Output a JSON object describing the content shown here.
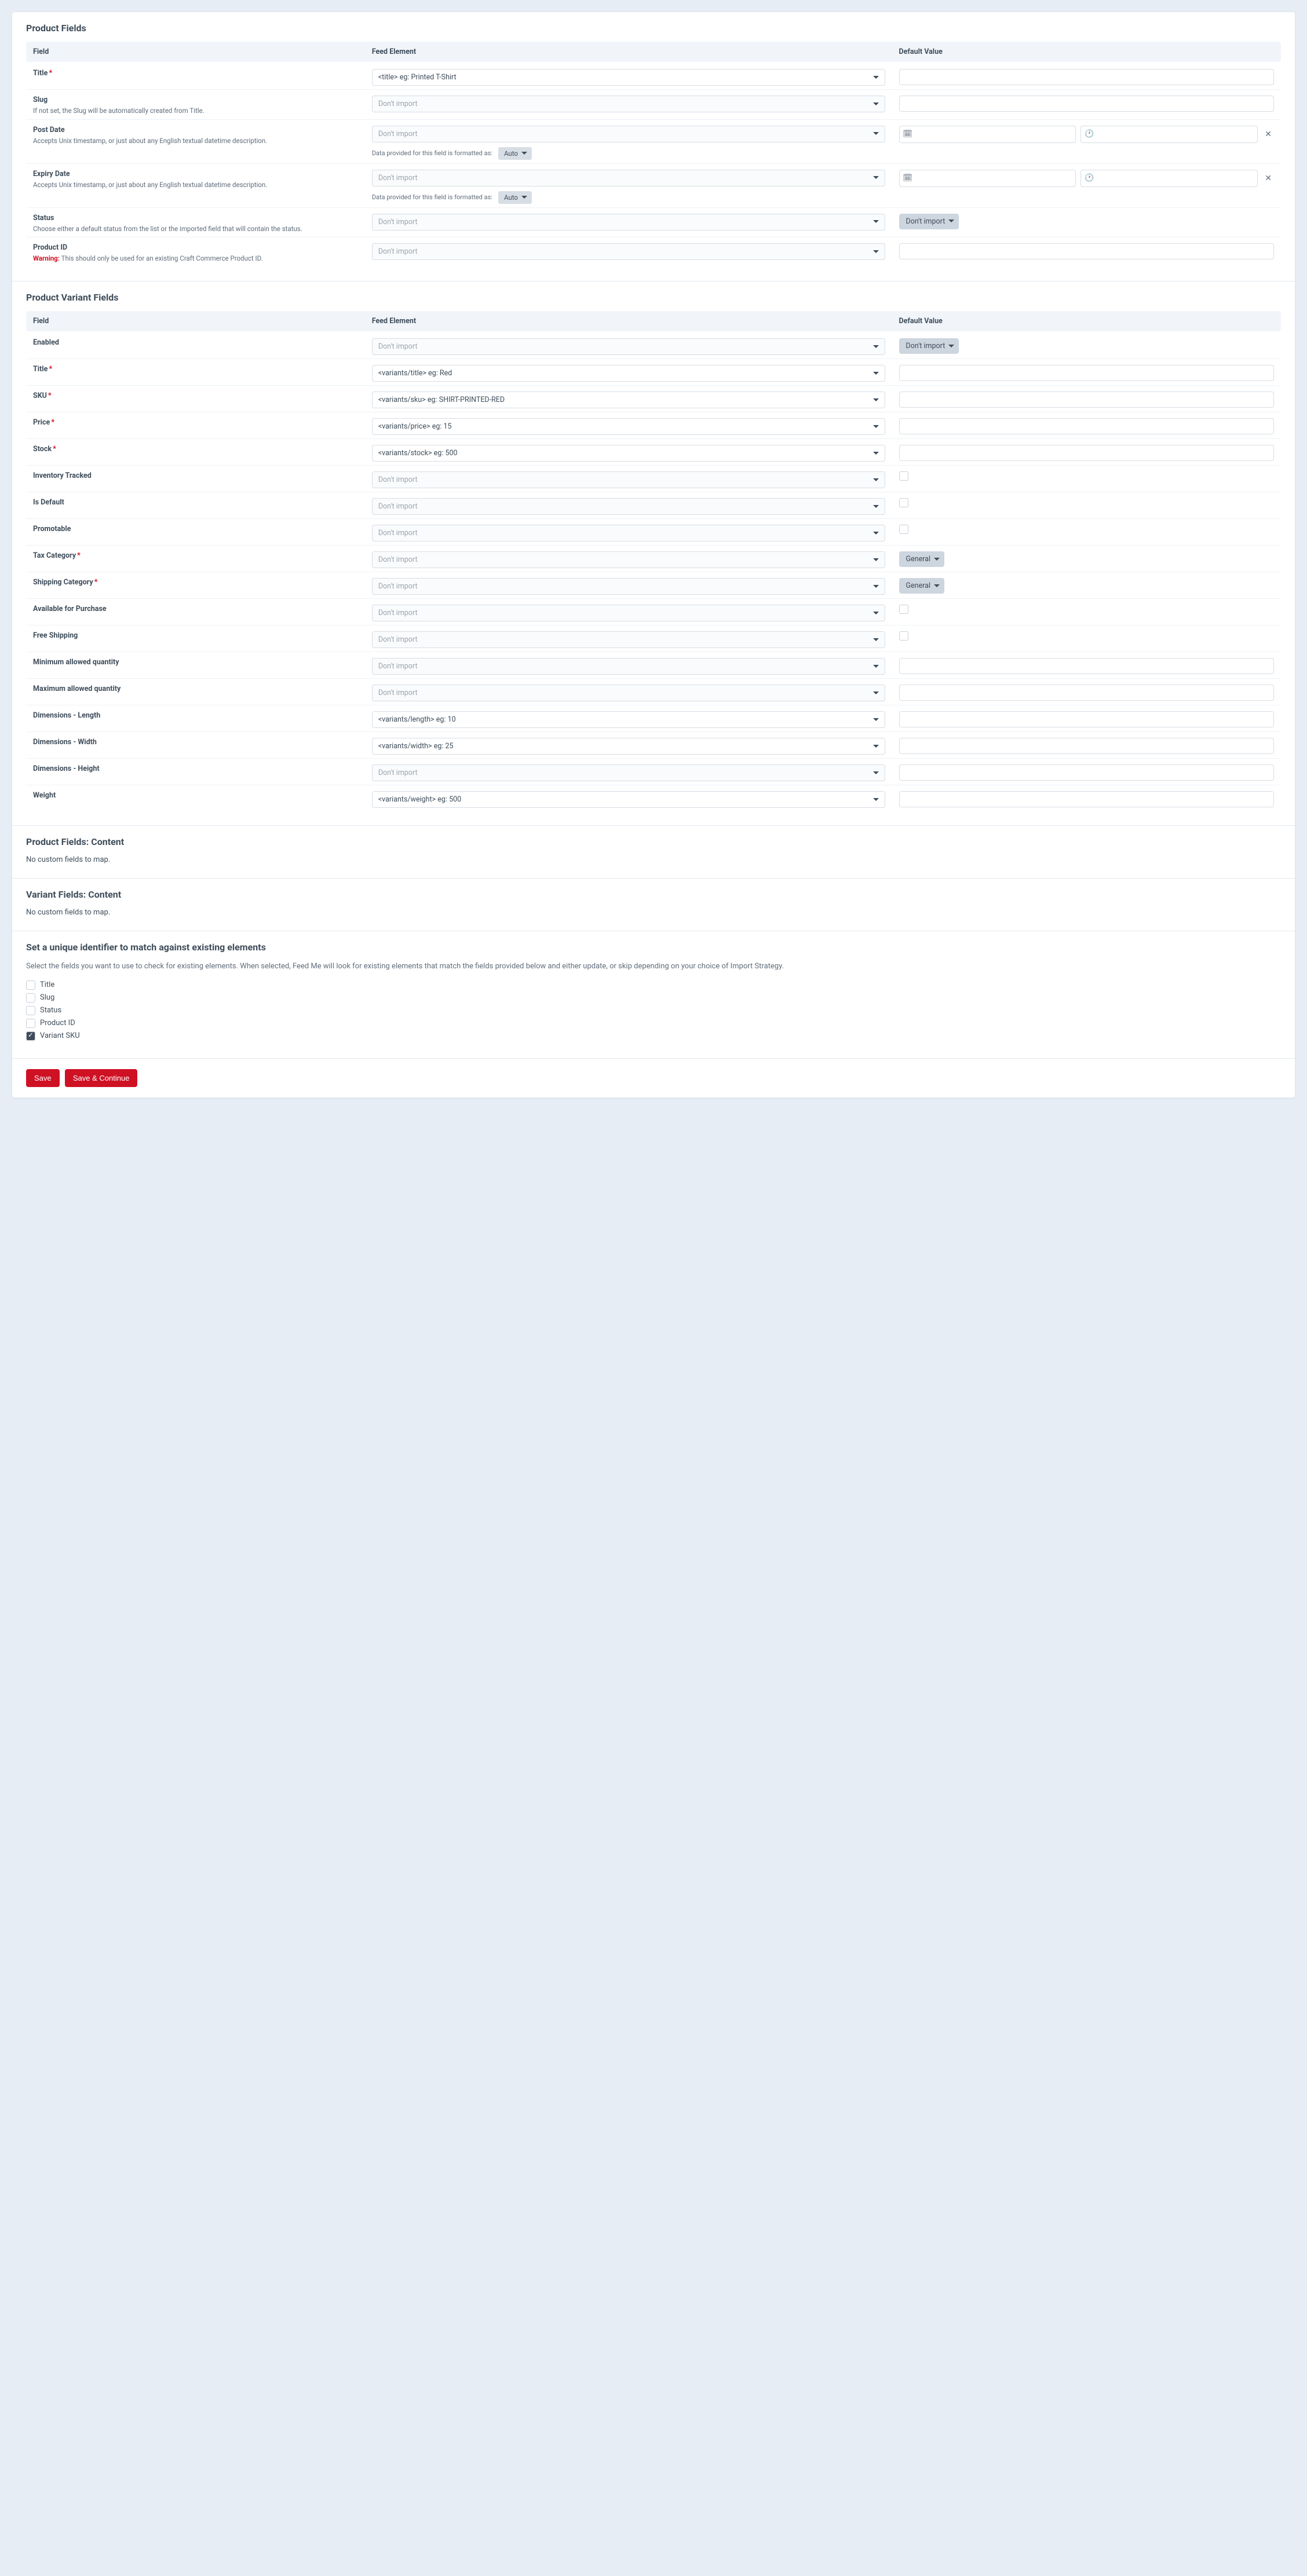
{
  "headers": {
    "field": "Field",
    "feed": "Feed Element",
    "default": "Default Value"
  },
  "common": {
    "dontImport": "Don't import",
    "formatLabel": "Data provided for this field is formatted as:",
    "auto": "Auto",
    "general": "General"
  },
  "sections": {
    "productFields": "Product Fields",
    "variantFields": "Product Variant Fields",
    "productContent": "Product Fields: Content",
    "variantContent": "Variant Fields: Content",
    "unique": "Set a unique identifier to match against existing elements"
  },
  "product": {
    "title": {
      "label": "Title",
      "value": "<title> eg: Printed T-Shirt"
    },
    "slug": {
      "label": "Slug",
      "desc": "If not set, the Slug will be automatically created from Title."
    },
    "postDate": {
      "label": "Post Date",
      "desc": "Accepts Unix timestamp, or just about any English textual datetime description."
    },
    "expiryDate": {
      "label": "Expiry Date",
      "desc": "Accepts Unix timestamp, or just about any English textual datetime description."
    },
    "status": {
      "label": "Status",
      "desc": "Choose either a default status from the list or the imported field that will contain the status."
    },
    "productId": {
      "label": "Product ID",
      "warning": "Warning:",
      "desc": " This should only be used for an existing Craft Commerce Product ID."
    }
  },
  "variant": {
    "enabled": {
      "label": "Enabled"
    },
    "title": {
      "label": "Title",
      "value": "<variants/title> eg: Red"
    },
    "sku": {
      "label": "SKU",
      "value": "<variants/sku> eg: SHIRT-PRINTED-RED"
    },
    "price": {
      "label": "Price",
      "value": "<variants/price> eg: 15"
    },
    "stock": {
      "label": "Stock",
      "value": "<variants/stock> eg: 500"
    },
    "inventoryTracked": {
      "label": "Inventory Tracked"
    },
    "isDefault": {
      "label": "Is Default"
    },
    "promotable": {
      "label": "Promotable"
    },
    "taxCategory": {
      "label": "Tax Category"
    },
    "shippingCategory": {
      "label": "Shipping Category"
    },
    "availableForPurchase": {
      "label": "Available for Purchase"
    },
    "freeShipping": {
      "label": "Free Shipping"
    },
    "minQty": {
      "label": "Minimum allowed quantity"
    },
    "maxQty": {
      "label": "Maximum allowed quantity"
    },
    "length": {
      "label": "Dimensions - Length",
      "value": "<variants/length> eg: 10"
    },
    "width": {
      "label": "Dimensions - Width",
      "value": "<variants/width> eg: 25"
    },
    "height": {
      "label": "Dimensions - Height"
    },
    "weight": {
      "label": "Weight",
      "value": "<variants/weight> eg: 500"
    }
  },
  "noCustom": "No custom fields to map.",
  "uniqueDesc": "Select the fields you want to use to check for existing elements. When selected, Feed Me will look for existing elements that match the fields provided below and either update, or skip depending on your choice of Import Strategy.",
  "uniqueOpts": {
    "title": "Title",
    "slug": "Slug",
    "status": "Status",
    "productId": "Product ID",
    "variantSku": "Variant SKU"
  },
  "buttons": {
    "save": "Save",
    "saveContinue": "Save & Continue"
  }
}
